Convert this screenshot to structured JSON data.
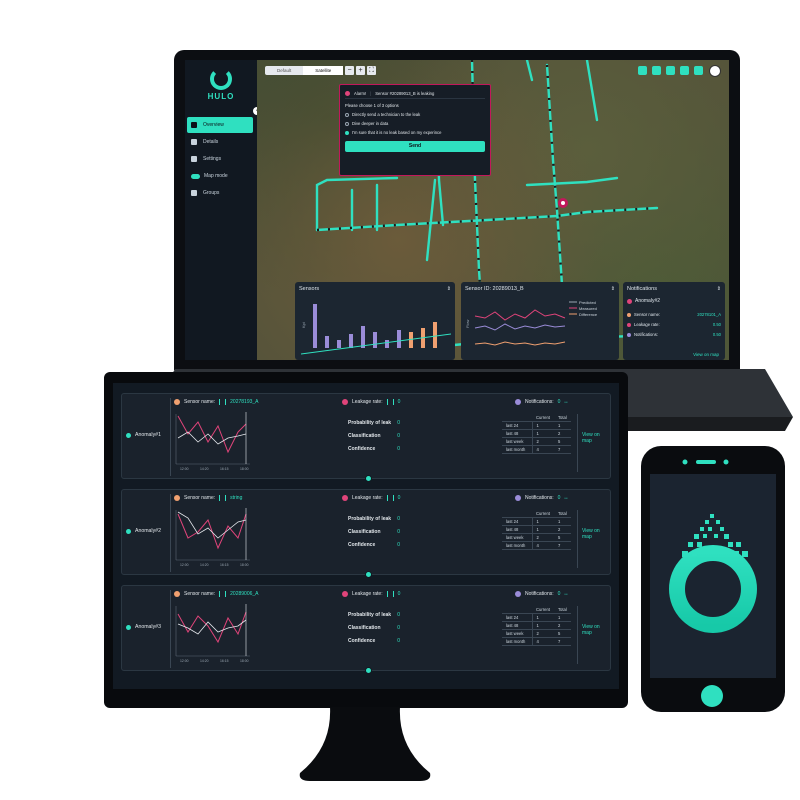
{
  "colors": {
    "accent": "#2fe0c0",
    "alarm": "#c2185b",
    "pink": "#e0447a",
    "orange": "#f0a070",
    "purple": "#9a8cd8"
  },
  "laptop": {
    "logo": "HULO",
    "nav": [
      {
        "label": "Overview",
        "icon": "overview-icon",
        "active": true
      },
      {
        "label": "Details",
        "icon": "details-icon"
      },
      {
        "label": "Settings",
        "icon": "gear-icon"
      },
      {
        "label": "Map mode",
        "icon": "toggle"
      },
      {
        "label": "Groups",
        "icon": "groups-icon"
      }
    ],
    "map_toggle": {
      "default": "Default",
      "satellite": "Satellite"
    },
    "alarm": {
      "title": "Alarm!",
      "sensor_msg": "Sensor #20289013_B is leaking",
      "prompt": "Please choose 1 of 3 options",
      "options": [
        "Directly send a technician to the leak",
        "Dive deeper in data",
        "I'm sure that it is no leak based on my experince"
      ],
      "selected_option": 2,
      "send": "Send"
    },
    "sensors_panel": {
      "title": "Sensors",
      "ylabel": "Kpi"
    },
    "sensor_id_panel": {
      "title": "Sensor ID: 20289013_B",
      "ylabel": "Flow",
      "legend": [
        "Predicted",
        "Measured",
        "Difference"
      ]
    },
    "notifications_panel": {
      "title": "Notifications",
      "anomaly": "Anomaly#2",
      "rows": [
        {
          "label": "Sensor name:",
          "value": "20278101_A"
        },
        {
          "label": "Leakage rate:",
          "value": "0.50"
        },
        {
          "label": "Notifications:",
          "value": "0.50"
        }
      ],
      "link": "View on map"
    }
  },
  "monitor": {
    "cards": [
      {
        "anomaly": "Anomaly#1",
        "sensor_label": "Sensor name:",
        "sensor_value": "20278193_A",
        "leak_label": "Leakage rate:",
        "leak_value": "0",
        "notif_label": "Notifications:",
        "notif_value": "0",
        "metrics": [
          {
            "label": "Probability of leak",
            "value": "0"
          },
          {
            "label": "Classification",
            "value": "0"
          },
          {
            "label": "Confidence",
            "value": "0"
          }
        ],
        "table_head": [
          "",
          "Current",
          "Total"
        ],
        "table": [
          [
            "last 24",
            "1",
            "1"
          ],
          [
            "last 48",
            "1",
            "2"
          ],
          [
            "last week",
            "2",
            "5"
          ],
          [
            "last month",
            "4",
            "7"
          ]
        ],
        "xticks": [
          "12:00",
          "14:20",
          "16:15",
          "18:00"
        ],
        "link": "View on map"
      },
      {
        "anomaly": "Anomaly#2",
        "sensor_label": "Sensor name:",
        "sensor_value": "string",
        "leak_label": "Leakage rate:",
        "leak_value": "0",
        "notif_label": "Notifications:",
        "notif_value": "0",
        "metrics": [
          {
            "label": "Probability of leak",
            "value": "0"
          },
          {
            "label": "Classification",
            "value": "0"
          },
          {
            "label": "Confidence",
            "value": "0"
          }
        ],
        "table_head": [
          "",
          "Current",
          "Total"
        ],
        "table": [
          [
            "last 24",
            "1",
            "1"
          ],
          [
            "last 48",
            "1",
            "2"
          ],
          [
            "last week",
            "2",
            "5"
          ],
          [
            "last month",
            "4",
            "7"
          ]
        ],
        "xticks": [
          "12:00",
          "14:20",
          "16:15",
          "18:00"
        ],
        "link": "View on map"
      },
      {
        "anomaly": "Anomaly#3",
        "sensor_label": "Sensor name:",
        "sensor_value": "20289006_A",
        "leak_label": "Leakage rate:",
        "leak_value": "0",
        "notif_label": "Notifications:",
        "notif_value": "0",
        "metrics": [
          {
            "label": "Probability of leak",
            "value": "0"
          },
          {
            "label": "Classification",
            "value": "0"
          },
          {
            "label": "Confidence",
            "value": "0"
          }
        ],
        "table_head": [
          "",
          "Current",
          "Total"
        ],
        "table": [
          [
            "last 24",
            "1",
            "1"
          ],
          [
            "last 48",
            "1",
            "2"
          ],
          [
            "last week",
            "2",
            "5"
          ],
          [
            "last month",
            "4",
            "7"
          ]
        ],
        "xticks": [
          "12:00",
          "14:20",
          "16:15",
          "18:00"
        ],
        "link": "View on map"
      }
    ]
  },
  "phone": {
    "logo_icon": "hulo-drop-logo-icon"
  }
}
